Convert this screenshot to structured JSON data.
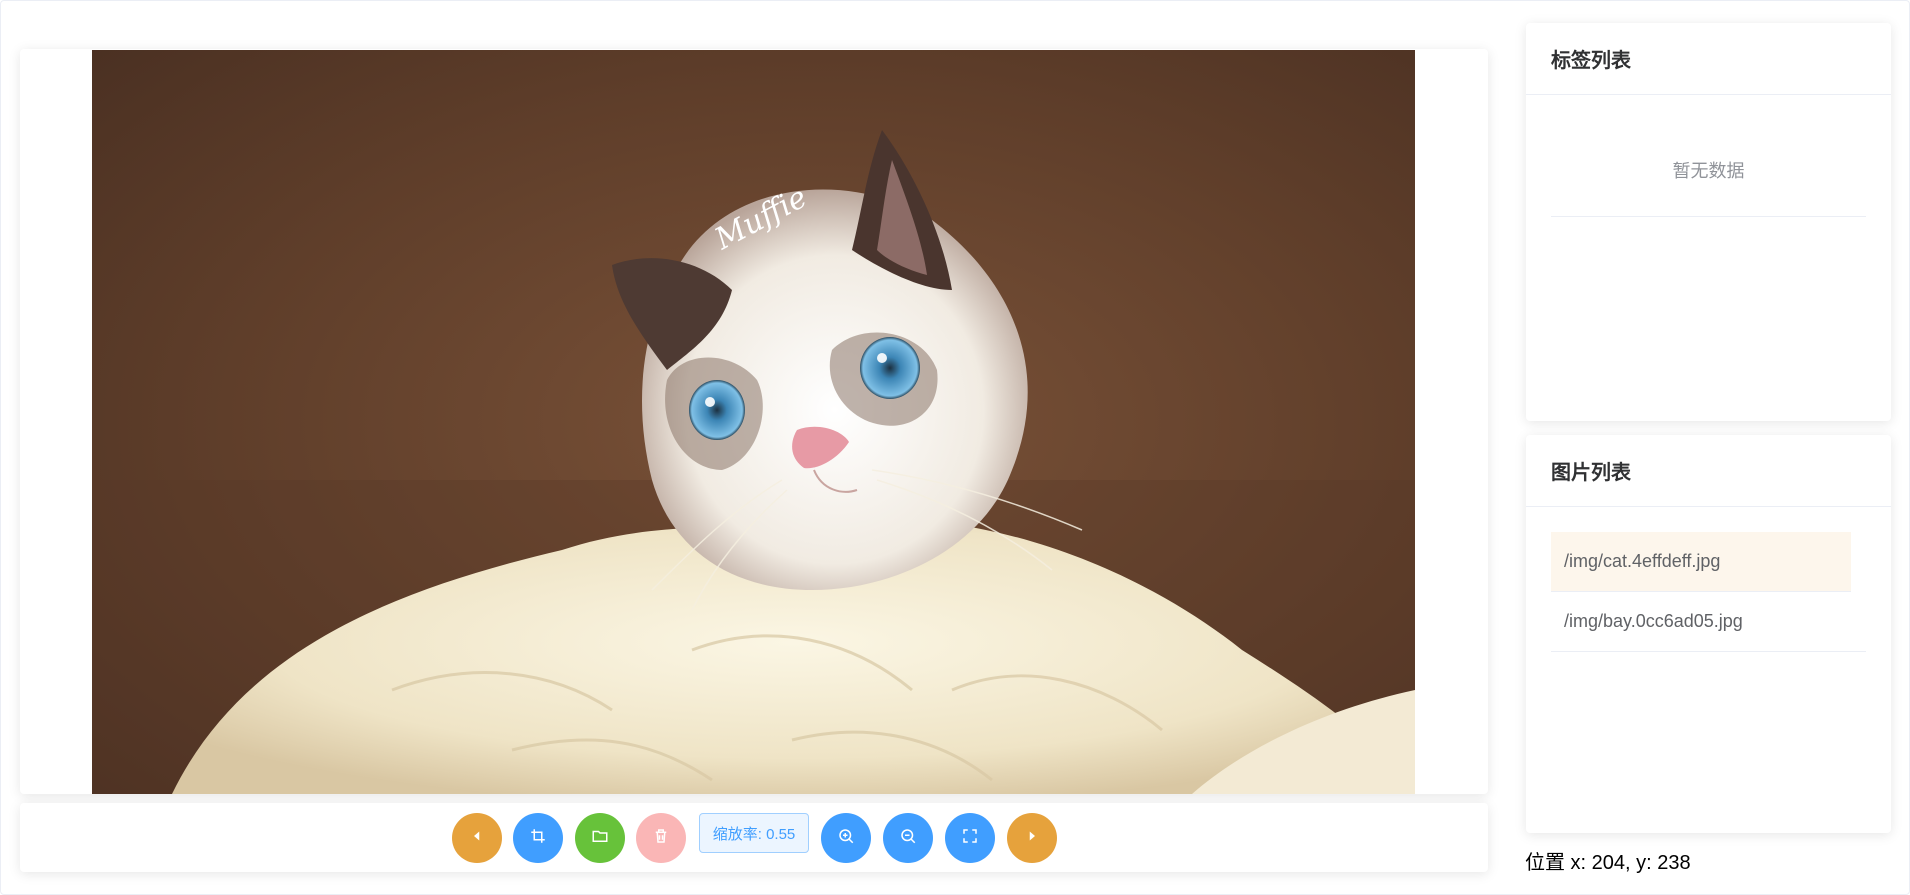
{
  "canvas": {
    "image_alt": "ragdoll cat photo",
    "watermark_text": "Muffie"
  },
  "toolbar": {
    "prev_icon": "caret-left-icon",
    "crop_icon": "crop-icon",
    "open_icon": "folder-icon",
    "delete_icon": "delete-icon",
    "zoom_label": "缩放率: 0.55",
    "zoom_in_icon": "zoom-in-icon",
    "zoom_out_icon": "zoom-out-icon",
    "fullscreen_icon": "fullscreen-icon",
    "next_icon": "caret-right-icon",
    "colors": {
      "orange": "#e6a23c",
      "blue": "#409eff",
      "green": "#67c23a",
      "pink": "#fab6b6"
    }
  },
  "tags_panel": {
    "title": "标签列表",
    "empty_text": "暂无数据"
  },
  "images_panel": {
    "title": "图片列表",
    "items": [
      {
        "label": "/img/cat.4effdeff.jpg",
        "active": true
      },
      {
        "label": "/img/bay.0cc6ad05.jpg",
        "active": false
      }
    ]
  },
  "position_readout": "位置 x: 204, y: 238"
}
